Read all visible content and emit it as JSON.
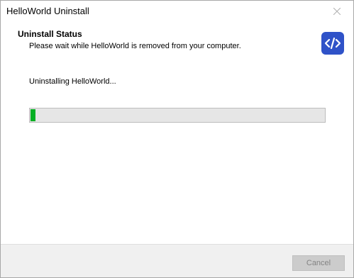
{
  "window": {
    "title": "HelloWorld Uninstall"
  },
  "header": {
    "title": "Uninstall Status",
    "subtitle": "Please wait while HelloWorld is removed from your computer.",
    "icon": "code-brackets-icon",
    "icon_color": "#2f52c8"
  },
  "main": {
    "status_text": "Uninstalling HelloWorld...",
    "progress_percent": 1,
    "progress_color": "#06b025"
  },
  "footer": {
    "cancel_label": "Cancel",
    "cancel_enabled": false
  }
}
